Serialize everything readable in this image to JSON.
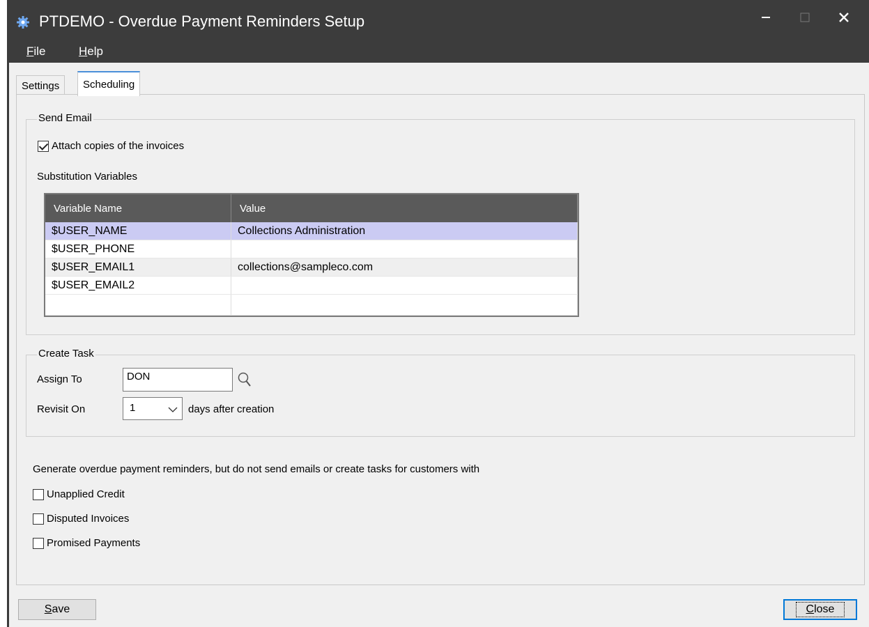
{
  "window": {
    "title": "PTDEMO - Overdue Payment Reminders Setup",
    "minimize_glyph": "–",
    "maximize_glyph": "☐",
    "close_glyph": "✕"
  },
  "menu": {
    "items": [
      {
        "label": "File",
        "mnemonic": "F",
        "rest": "ile"
      },
      {
        "label": "Help",
        "mnemonic": "H",
        "rest": "elp"
      }
    ]
  },
  "tabs": [
    {
      "label": "Settings",
      "active": false
    },
    {
      "label": "Scheduling",
      "active": true
    }
  ],
  "send_email": {
    "title": "Send Email",
    "attach_checkbox": {
      "label": "Attach copies of the invoices",
      "checked": true
    },
    "substitution_label": "Substitution Variables",
    "grid": {
      "columns": [
        "Variable Name",
        "Value"
      ],
      "rows": [
        {
          "name": "$USER_NAME",
          "value": "Collections Administration",
          "selected": true
        },
        {
          "name": "$USER_PHONE",
          "value": ""
        },
        {
          "name": "$USER_EMAIL1",
          "value": "collections@sampleco.com"
        },
        {
          "name": "$USER_EMAIL2",
          "value": ""
        },
        {
          "name": "",
          "value": ""
        }
      ]
    }
  },
  "create_task": {
    "title": "Create Task",
    "assign_to_label": "Assign To",
    "assign_to_value": "DON",
    "revisit_on_label": "Revisit On",
    "revisit_on_value": "1",
    "days_after_label": "days after creation"
  },
  "exclusions": {
    "description": "Generate overdue payment reminders, but do not send emails or create tasks for customers with",
    "options": [
      {
        "label": "Unapplied Credit",
        "checked": false
      },
      {
        "label": "Disputed Invoices",
        "checked": false
      },
      {
        "label": "Promised Payments",
        "checked": false
      }
    ]
  },
  "buttons": {
    "save": {
      "label": "Save",
      "mnemonic": "S",
      "rest": "ave"
    },
    "close": {
      "label": "Close",
      "mnemonic": "C",
      "rest": "lose"
    }
  },
  "colors": {
    "titlebar": "#3c3c3c",
    "tab_accent": "#4a8fd9",
    "selected_row": "#cbcbf3",
    "default_button_border": "#0078d7"
  }
}
